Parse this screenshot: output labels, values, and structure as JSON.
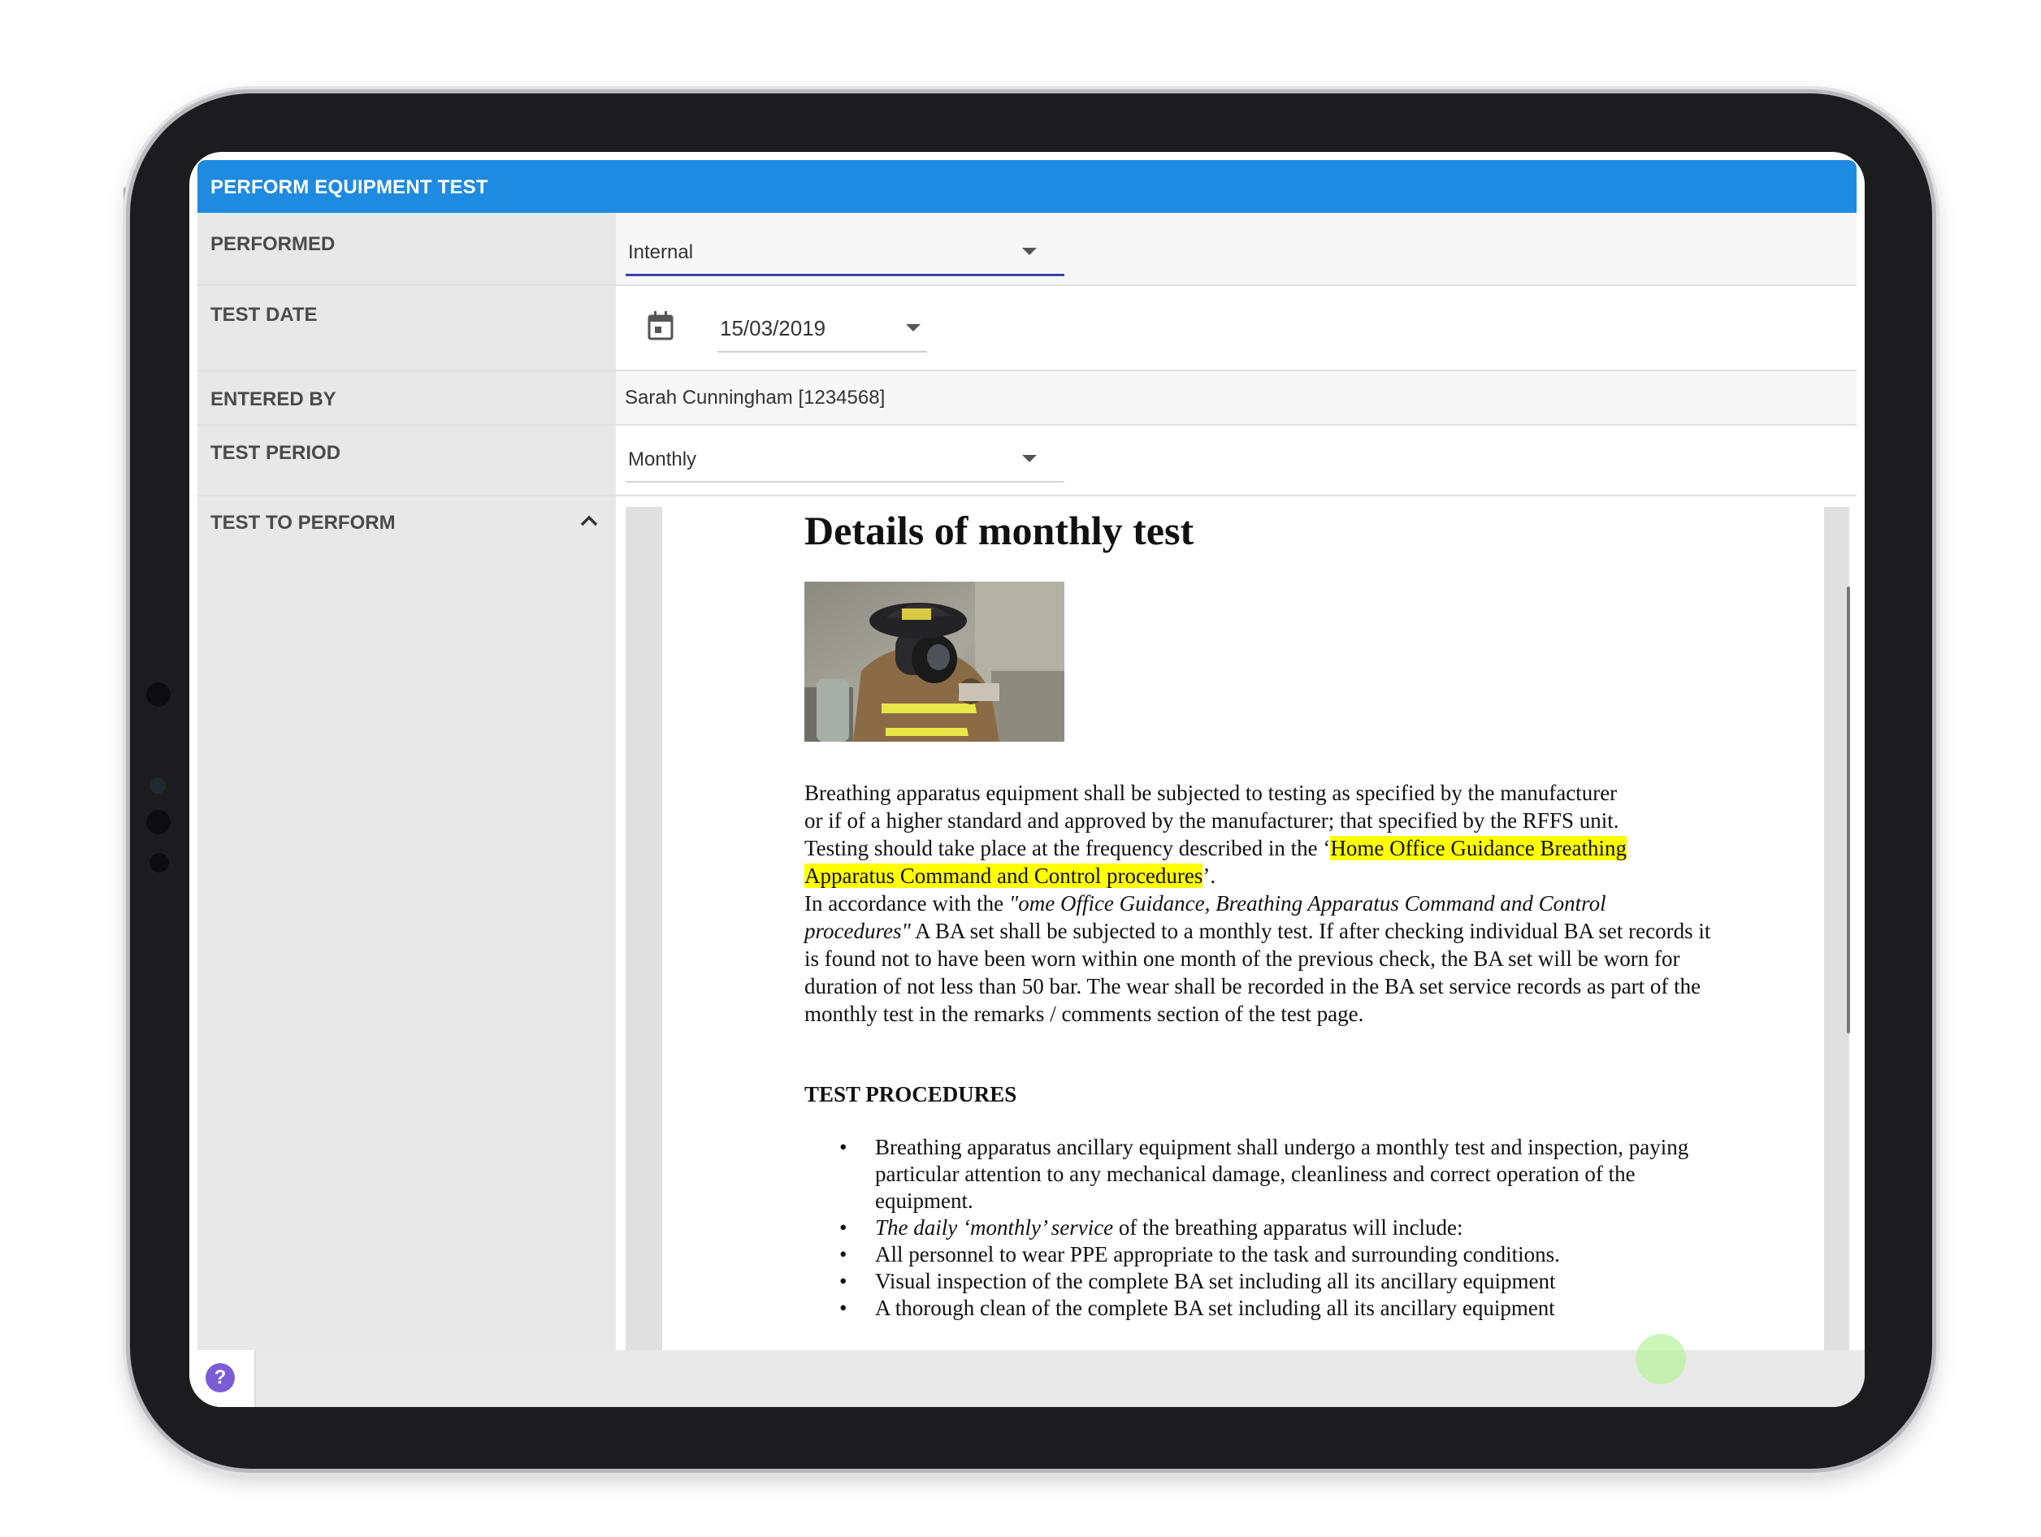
{
  "header": {
    "title": "PERFORM EQUIPMENT TEST"
  },
  "form": {
    "performed": {
      "label": "PERFORMED",
      "value": "Internal"
    },
    "test_date": {
      "label": "TEST DATE",
      "value": "15/03/2019"
    },
    "entered_by": {
      "label": "ENTERED BY",
      "value": "Sarah Cunningham [1234568]"
    },
    "test_period": {
      "label": "TEST PERIOD",
      "value": "Monthly"
    },
    "test_to_perform": {
      "label": "TEST TO PERFORM"
    }
  },
  "document": {
    "title": "Details of monthly test",
    "para1": {
      "lines": [
        "Breathing apparatus equipment shall be subjected to testing as specified by the manufacturer",
        "or if of a higher standard and approved by the manufacturer; that specified by the RFFS unit."
      ],
      "line3_pre": "Testing should take place at the frequency described in the ‘",
      "line3_hl": "Home Office Guidance Breathing",
      "line4_hl": "Apparatus Command and Control procedures",
      "line4_post": "’."
    },
    "para2": {
      "pre": "In accordance with the ",
      "italic": "\"ome Office Guidance, Breathing Apparatus Command and Control procedures\"",
      "post": " A BA set shall be subjected to a monthly test. If after checking individual BA set records it is found not to have been worn within one month of the previous check, the BA set will be worn for duration of not less than 50 bar. The wear shall be recorded in the BA set service records as part of the monthly test in the remarks / comments section of the test page."
    },
    "section_heading": "TEST PROCEDURES",
    "bullets": [
      {
        "text": "Breathing apparatus ancillary equipment shall undergo a monthly test and inspection, paying particular attention to any mechanical damage, cleanliness and correct operation of the equipment."
      },
      {
        "italic": "The daily ‘monthly’ service",
        "text": " of the breathing apparatus will include:"
      },
      {
        "text": "All personnel to wear PPE appropriate to the task and surrounding conditions."
      },
      {
        "text": "Visual inspection of the complete BA set including all its ancillary equipment"
      },
      {
        "text": "A thorough clean of the complete BA set including all its ancillary equipment"
      }
    ]
  },
  "footer": {
    "help_label": "?"
  },
  "colors": {
    "header": "#1e8ae0",
    "highlight": "#ffff00",
    "help": "#7b5cd6"
  },
  "icons": [
    "calendar-icon",
    "chevron-up-icon",
    "chevron-down-icon",
    "help-icon"
  ]
}
